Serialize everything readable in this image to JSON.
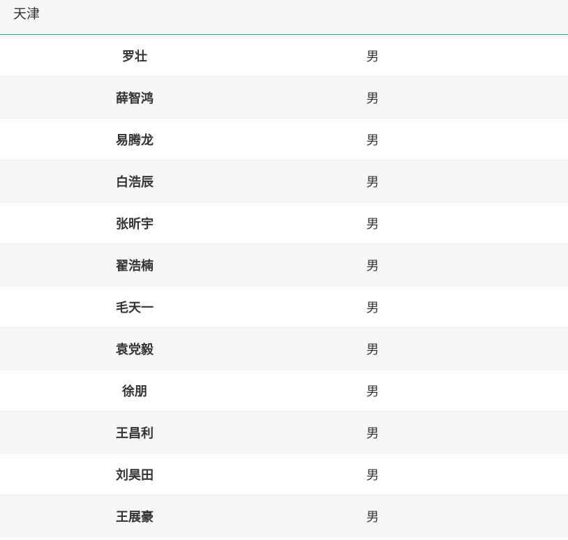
{
  "group": {
    "title": "天津"
  },
  "rows": [
    {
      "name": "罗壮",
      "gender": "男"
    },
    {
      "name": "薛智鸿",
      "gender": "男"
    },
    {
      "name": "易腾龙",
      "gender": "男"
    },
    {
      "name": "白浩辰",
      "gender": "男"
    },
    {
      "name": "张昕宇",
      "gender": "男"
    },
    {
      "name": "翟浩楠",
      "gender": "男"
    },
    {
      "name": "毛天一",
      "gender": "男"
    },
    {
      "name": "袁党毅",
      "gender": "男"
    },
    {
      "name": "徐朋",
      "gender": "男"
    },
    {
      "name": "王昌利",
      "gender": "男"
    },
    {
      "name": "刘昊田",
      "gender": "男"
    },
    {
      "name": "王展豪",
      "gender": "男"
    }
  ]
}
